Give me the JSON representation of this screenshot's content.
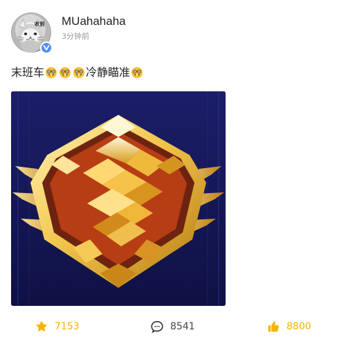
{
  "post": {
    "author": {
      "name": "MUahahaha",
      "avatar_text": "收到",
      "verified": true
    },
    "timestamp": "3分钟前",
    "content": {
      "text_part_1": "末班车",
      "text_part_2": "冷静瞄准",
      "emoji_name": "nerd-face-emoji"
    },
    "image": {
      "alt": ""
    }
  },
  "actions": {
    "favorite_count": "7153",
    "comment_count": "8541",
    "like_count": "8800"
  },
  "icons": {
    "favorite": "star-icon",
    "comment": "comment-icon",
    "like": "thumbs-up-icon",
    "verified": "verified-badge-icon"
  },
  "colors": {
    "accent_gold": "#f4b400",
    "verified_blue": "#4f8cff",
    "muted_text": "#9a9a9a",
    "image_navy": "#14164f"
  }
}
